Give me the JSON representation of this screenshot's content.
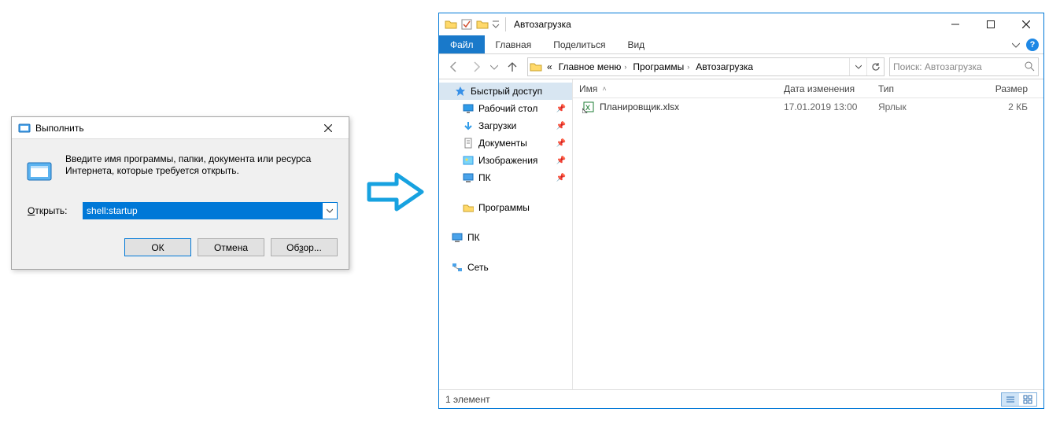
{
  "run": {
    "title": "Выполнить",
    "description": "Введите имя программы, папки, документа или ресурса Интернета, которые требуется открыть.",
    "open_label": "Открыть:",
    "open_value": "shell:startup",
    "ok": "ОК",
    "cancel": "Отмена",
    "browse": "Обзор..."
  },
  "explorer": {
    "titlebar": {
      "app_title": "Автозагрузка"
    },
    "ribbon": {
      "file": "Файл",
      "home": "Главная",
      "share": "Поделиться",
      "view": "Вид"
    },
    "breadcrumb": {
      "prefix": "«",
      "items": [
        "Главное меню",
        "Программы",
        "Автозагрузка"
      ]
    },
    "search_placeholder": "Поиск: Автозагрузка",
    "sidebar": {
      "quick_access": "Быстрый доступ",
      "items": [
        {
          "icon": "desktop",
          "label": "Рабочий стол"
        },
        {
          "icon": "download",
          "label": "Загрузки"
        },
        {
          "icon": "document",
          "label": "Документы"
        },
        {
          "icon": "picture",
          "label": "Изображения"
        },
        {
          "icon": "pc",
          "label": "ПК"
        }
      ],
      "programs": "Программы",
      "pc": "ПК",
      "network": "Сеть"
    },
    "columns": {
      "name": "Имя",
      "date": "Дата изменения",
      "type": "Тип",
      "size": "Размер"
    },
    "files": [
      {
        "name": "Планировщик.xlsx",
        "date": "17.01.2019 13:00",
        "type": "Ярлык",
        "size": "2 КБ"
      }
    ],
    "status": "1 элемент"
  }
}
